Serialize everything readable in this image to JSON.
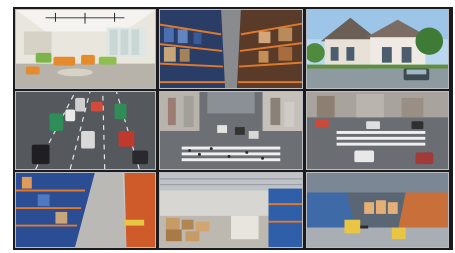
{
  "grid": {
    "rows": 3,
    "cols": 3,
    "tiles": [
      {
        "scene": "modern-office-lounge-icon"
      },
      {
        "scene": "warehouse-rack-aisle-icon"
      },
      {
        "scene": "house-exterior-with-car-icon"
      },
      {
        "scene": "highway-traffic-icon"
      },
      {
        "scene": "city-intersection-crosswalk-icon"
      },
      {
        "scene": "urban-road-crossing-icon"
      },
      {
        "scene": "warehouse-shelving-blue-icon"
      },
      {
        "scene": "warehouse-boxes-hall-icon"
      },
      {
        "scene": "warehouse-forklift-icon"
      }
    ]
  },
  "colors": {
    "frame": "#1b1b1d",
    "divider": "#b9bcc0",
    "rack_orange": "#e0792a",
    "rack_blue": "#2f5fa8"
  }
}
